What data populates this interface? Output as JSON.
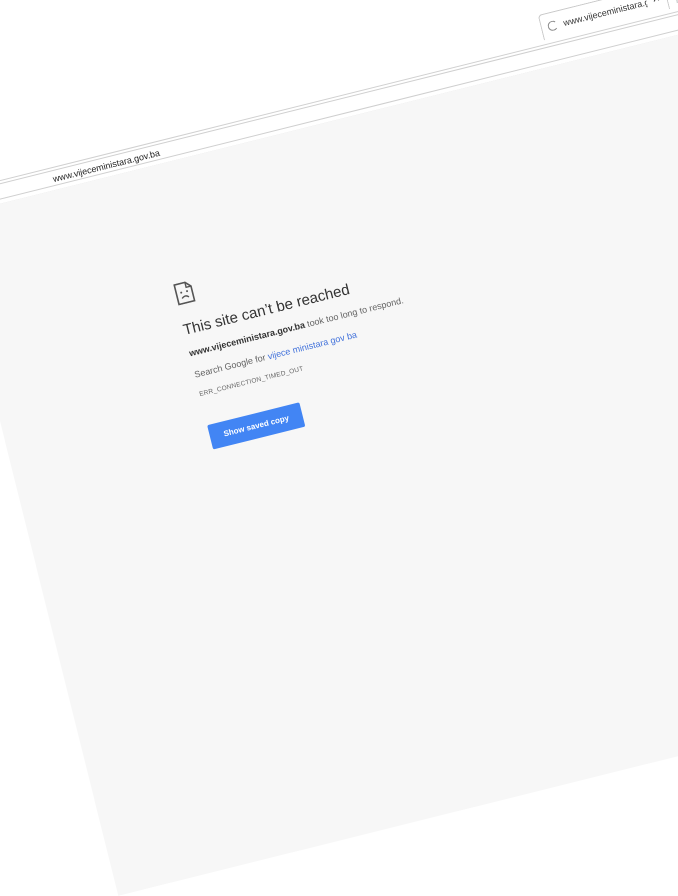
{
  "tab": {
    "title": "www.vijeceministara.gov.ba",
    "close": "✕"
  },
  "omnibox": {
    "url": "www.vijeceministara.gov.ba"
  },
  "error": {
    "heading": "This site can’t be reached",
    "host": "www.vijeceministara.gov.ba",
    "message_tail": "took too long to respond.",
    "search_prefix": "Search Google for",
    "search_link": "vijece ministara gov ba",
    "code": "ERR_CONNECTION_TIMED_OUT",
    "button": "Show saved copy"
  },
  "colors": {
    "button": "#4285f4",
    "link": "#4272db",
    "content_bg": "#f7f7f7"
  },
  "icons": {
    "tab_loading": "spinner-icon",
    "error": "sad-page-icon"
  }
}
